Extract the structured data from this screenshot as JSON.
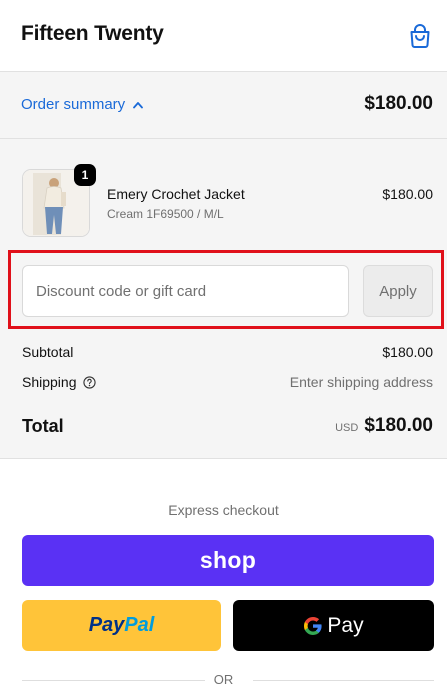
{
  "header": {
    "store_name": "Fifteen Twenty",
    "cart_icon": "shopping-bag-icon"
  },
  "summary": {
    "toggle_label": "Order summary",
    "toggle_icon": "chevron-up-icon",
    "total": "$180.00"
  },
  "line_items": [
    {
      "quantity": "1",
      "name": "Emery Crochet Jacket",
      "variant": "Cream 1F69500 / M/L",
      "price": "$180.00"
    }
  ],
  "discount": {
    "placeholder": "Discount code or gift card",
    "apply_label": "Apply"
  },
  "totals": {
    "subtotal_label": "Subtotal",
    "subtotal_value": "$180.00",
    "shipping_label": "Shipping",
    "shipping_icon": "help-circle-icon",
    "shipping_value": "Enter shipping address",
    "total_label": "Total",
    "currency": "USD",
    "total_value": "$180.00"
  },
  "express": {
    "title": "Express checkout",
    "shop_label": "shop",
    "paypal_label_part1": "Pay",
    "paypal_label_part2": "Pal",
    "gpay_label": "Pay",
    "divider_label": "OR"
  },
  "colors": {
    "link_blue": "#1a6ad8",
    "shop_purple": "#5a31f4",
    "paypal_yellow": "#ffc439",
    "gpay_black": "#000000",
    "highlight_red": "#e0101a"
  }
}
